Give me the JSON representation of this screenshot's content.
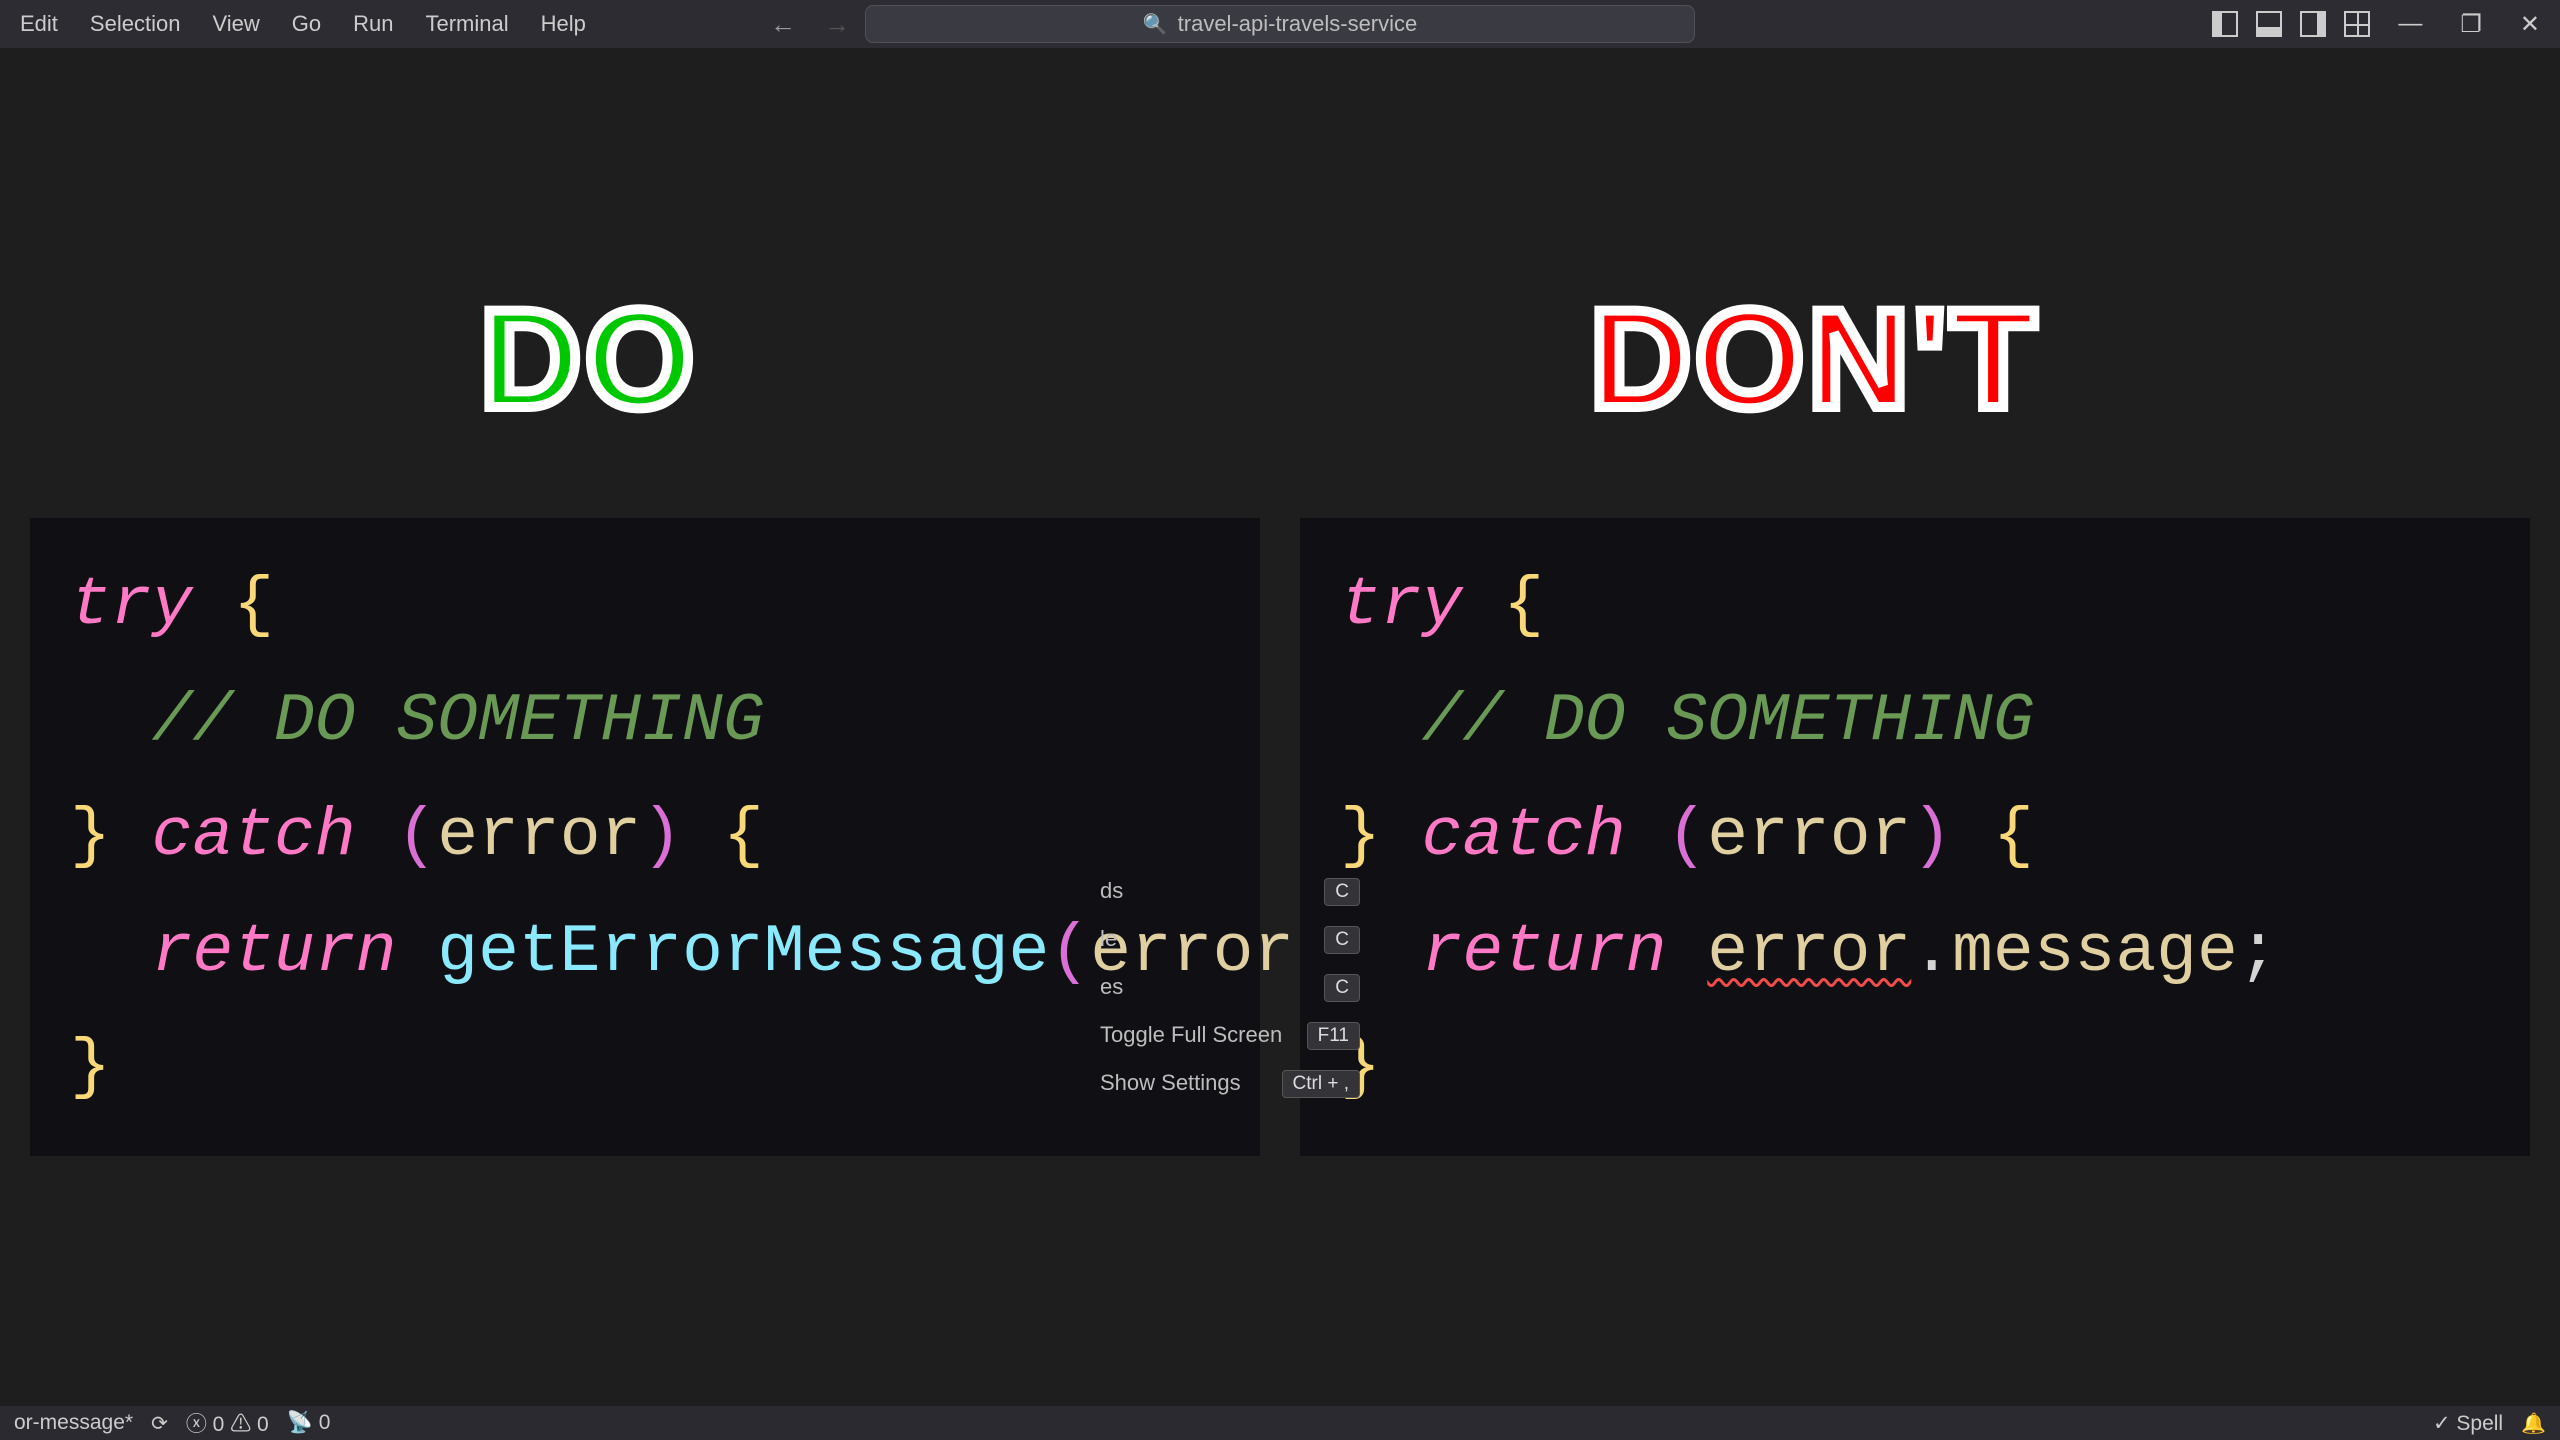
{
  "menu": {
    "items": [
      "Edit",
      "Selection",
      "View",
      "Go",
      "Run",
      "Terminal",
      "Help"
    ]
  },
  "search": {
    "text": "travel-api-travels-service"
  },
  "headings": {
    "do": "DO",
    "dont": "DON'T"
  },
  "code": {
    "left": {
      "l1_kw": "try",
      "l1_br": " {",
      "l2_cm": "  // DO SOMETHING",
      "l3_br": "}",
      "l3_kw": " catch ",
      "l3_p1": "(",
      "l3_id": "error",
      "l3_p2": ")",
      "l3_br2": " {",
      "l4_kw": "  return ",
      "l4_fn": "getErrorMessage",
      "l4_p1": "(",
      "l4_id": "error",
      "l4_p2": ")",
      "l4_sc": ";",
      "l5_br": "}"
    },
    "right": {
      "l1_kw": "try",
      "l1_br": " {",
      "l2_cm": "  // DO SOMETHING",
      "l3_br": "}",
      "l3_kw": " catch ",
      "l3_p1": "(",
      "l3_id": "error",
      "l3_p2": ")",
      "l3_br2": " {",
      "l4_kw": "  return ",
      "l4_id1": "error",
      "l4_dot": ".",
      "l4_id2": "message",
      "l4_sc": ";",
      "l5_br": "}"
    }
  },
  "wb_menu": {
    "r1_label": "ds",
    "r1_kbd": "C",
    "r2_label": "le",
    "r2_kbd": "C",
    "r3_label": "es",
    "r3_kbd": "C",
    "r4_label": "Toggle Full Screen",
    "r4_kbd": "F11",
    "r5_label": "Show Settings",
    "r5_kbd": "Ctrl + ,"
  },
  "status": {
    "file": "or-message*",
    "errors": "0",
    "warnings": "0",
    "ports": "0",
    "spell": "Spell"
  }
}
